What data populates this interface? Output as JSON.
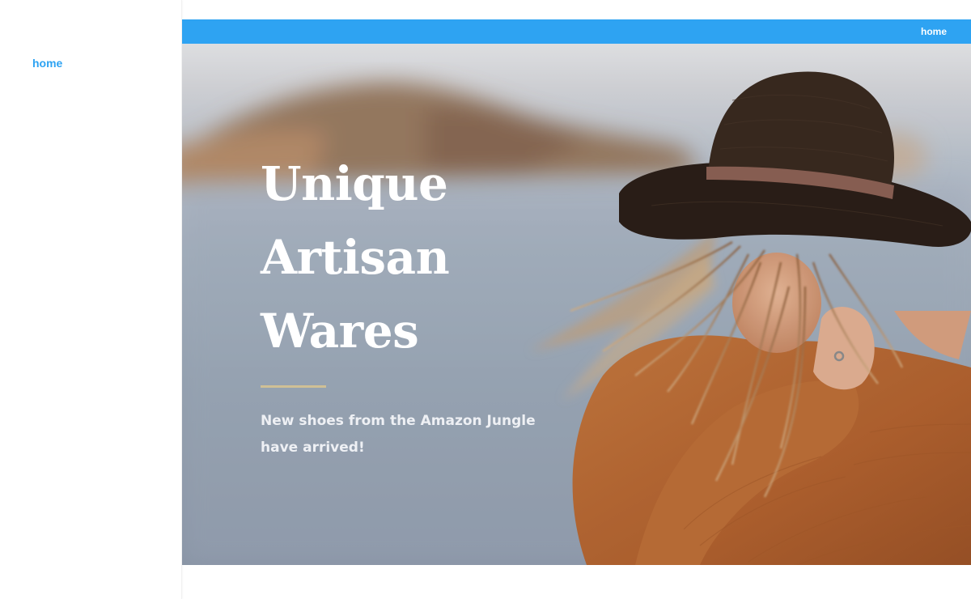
{
  "sidebar": {
    "nav_items": [
      {
        "label": "home"
      }
    ]
  },
  "topbar": {
    "nav_items": [
      {
        "label": "home"
      }
    ]
  },
  "hero": {
    "title_lines": [
      "Unique",
      "Artisan",
      "Wares"
    ],
    "subtitle": "New shoes from the Amazon Jungle have arrived!"
  },
  "colors": {
    "accent": "#2ea3f2",
    "divider": "#cfc095",
    "sweater": "#b8693a",
    "hat": "#2e2119"
  }
}
